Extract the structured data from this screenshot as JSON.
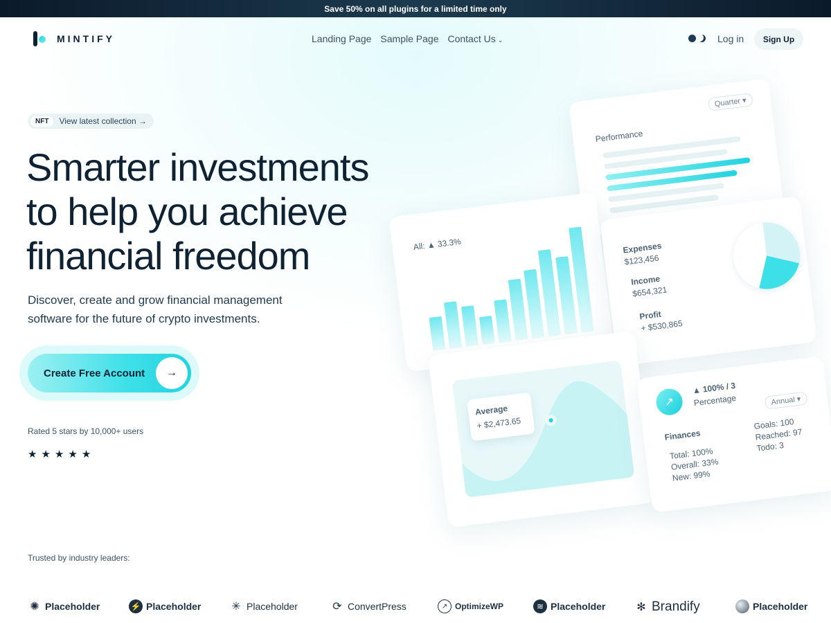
{
  "promo": {
    "text": "Save 50% on all plugins for a limited time only"
  },
  "brand": {
    "name": "MINTIFY"
  },
  "nav": {
    "items": [
      "Landing Page",
      "Sample Page",
      "Contact Us"
    ],
    "dropdown_icon": "chevron-down-icon"
  },
  "header": {
    "login": "Log in",
    "signup": "Sign Up",
    "theme_icon": "theme-toggle-icon"
  },
  "hero": {
    "pill_tag": "NFT",
    "pill_text": "View latest collection →",
    "headline": [
      "Smarter investments",
      "to help you achieve",
      "financial freedom"
    ],
    "subhead": "Discover, create and grow financial management software for the future of crypto investments.",
    "cta": "Create Free Account",
    "cta_arrow": "→",
    "rated": "Rated 5 stars by 10,000+ users",
    "rating": 5,
    "star_glyph": "★"
  },
  "dashboard": {
    "performance": {
      "title": "Performance",
      "select": "Quarter ▾",
      "bars": [
        0.95,
        0.85,
        1.0,
        0.9,
        0.8,
        0.75
      ]
    },
    "bars": {
      "label": "All: ▲ 33.3%",
      "values": [
        0.3,
        0.42,
        0.36,
        0.25,
        0.38,
        0.55,
        0.62,
        0.78,
        0.7,
        0.95
      ]
    },
    "split": {
      "expenses_label": "Expenses",
      "expenses_value": "$123,456",
      "income_label": "Income",
      "income_value": "$654,321",
      "profit_label": "Profit",
      "profit_value": "+ $530,865"
    },
    "average": {
      "label": "Average",
      "value": "+ $2,473.65"
    },
    "finances": {
      "badge_icon": "trending-up-icon",
      "headline": "▲ 100% / 3",
      "sub": "Percentage",
      "select": "Annual ▾",
      "title": "Finances",
      "left": [
        "Total: 100%",
        "Overall: 33%",
        "New: 99%"
      ],
      "right": [
        "Goals: 100",
        "Reached: 97",
        "Todo: 3"
      ]
    }
  },
  "trusted": {
    "label": "Trusted by industry leaders:",
    "logos": [
      {
        "name": "Placeholder",
        "icon": "sunburst-icon"
      },
      {
        "name": "Placeholder",
        "icon": "bolt-icon"
      },
      {
        "name": "Placeholder",
        "icon": "spark-icon"
      },
      {
        "name": "ConvertPress",
        "icon": "refresh-icon"
      },
      {
        "name": "OptimizeWP",
        "icon": "chart-icon"
      },
      {
        "name": "Placeholder",
        "icon": "wave-icon"
      },
      {
        "name": "Brandify",
        "icon": "asterisk-icon"
      },
      {
        "name": "Placeholder",
        "icon": "sphere-icon"
      }
    ]
  },
  "colors": {
    "accent": "#22d3e0",
    "ink": "#0f2234",
    "muted": "#3a5265"
  }
}
